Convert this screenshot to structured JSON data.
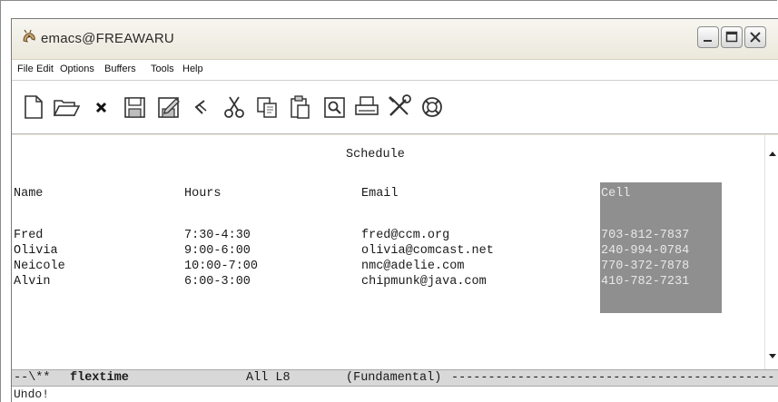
{
  "window": {
    "title": "emacs@FREAWARU",
    "buttons": [
      "minimize",
      "maximize",
      "close"
    ]
  },
  "menubar": {
    "items": [
      "File",
      "Edit",
      "Options",
      "Buffers",
      "Tools",
      "Help"
    ]
  },
  "toolbar": {
    "icons": [
      "new-file-icon",
      "open-folder-icon",
      "close-buffer-icon",
      "save-icon",
      "save-as-icon",
      "undo-icon",
      "cut-icon",
      "copy-icon",
      "paste-icon",
      "search-icon",
      "print-icon",
      "preferences-icon",
      "help-lifesaver-icon"
    ]
  },
  "buffer": {
    "heading": "Schedule",
    "columns": [
      "Name",
      "Hours",
      "Email",
      "Cell"
    ],
    "rows": [
      [
        "Fred",
        "7:30-4:30",
        "fred@ccm.org",
        "703-812-7837"
      ],
      [
        "Olivia",
        "9:00-6:00",
        "olivia@comcast.net",
        "240-994-0784"
      ],
      [
        "Neicole",
        "10:00-7:00",
        "nmc@adelie.com",
        "770-372-7878"
      ],
      [
        "Alvin",
        "6:00-3:00",
        "chipmunk@java.com",
        "410-782-7231"
      ]
    ]
  },
  "modeline": {
    "status": "--\\**",
    "buffer_name": "flextime",
    "position": "All L8",
    "mode": "(Fundamental)",
    "fill": "--------------------------------------------"
  },
  "echo": {
    "message": "Undo!"
  },
  "colors": {
    "highlight_column": "#8f8f8f",
    "window_chrome": "#ece9d8"
  }
}
